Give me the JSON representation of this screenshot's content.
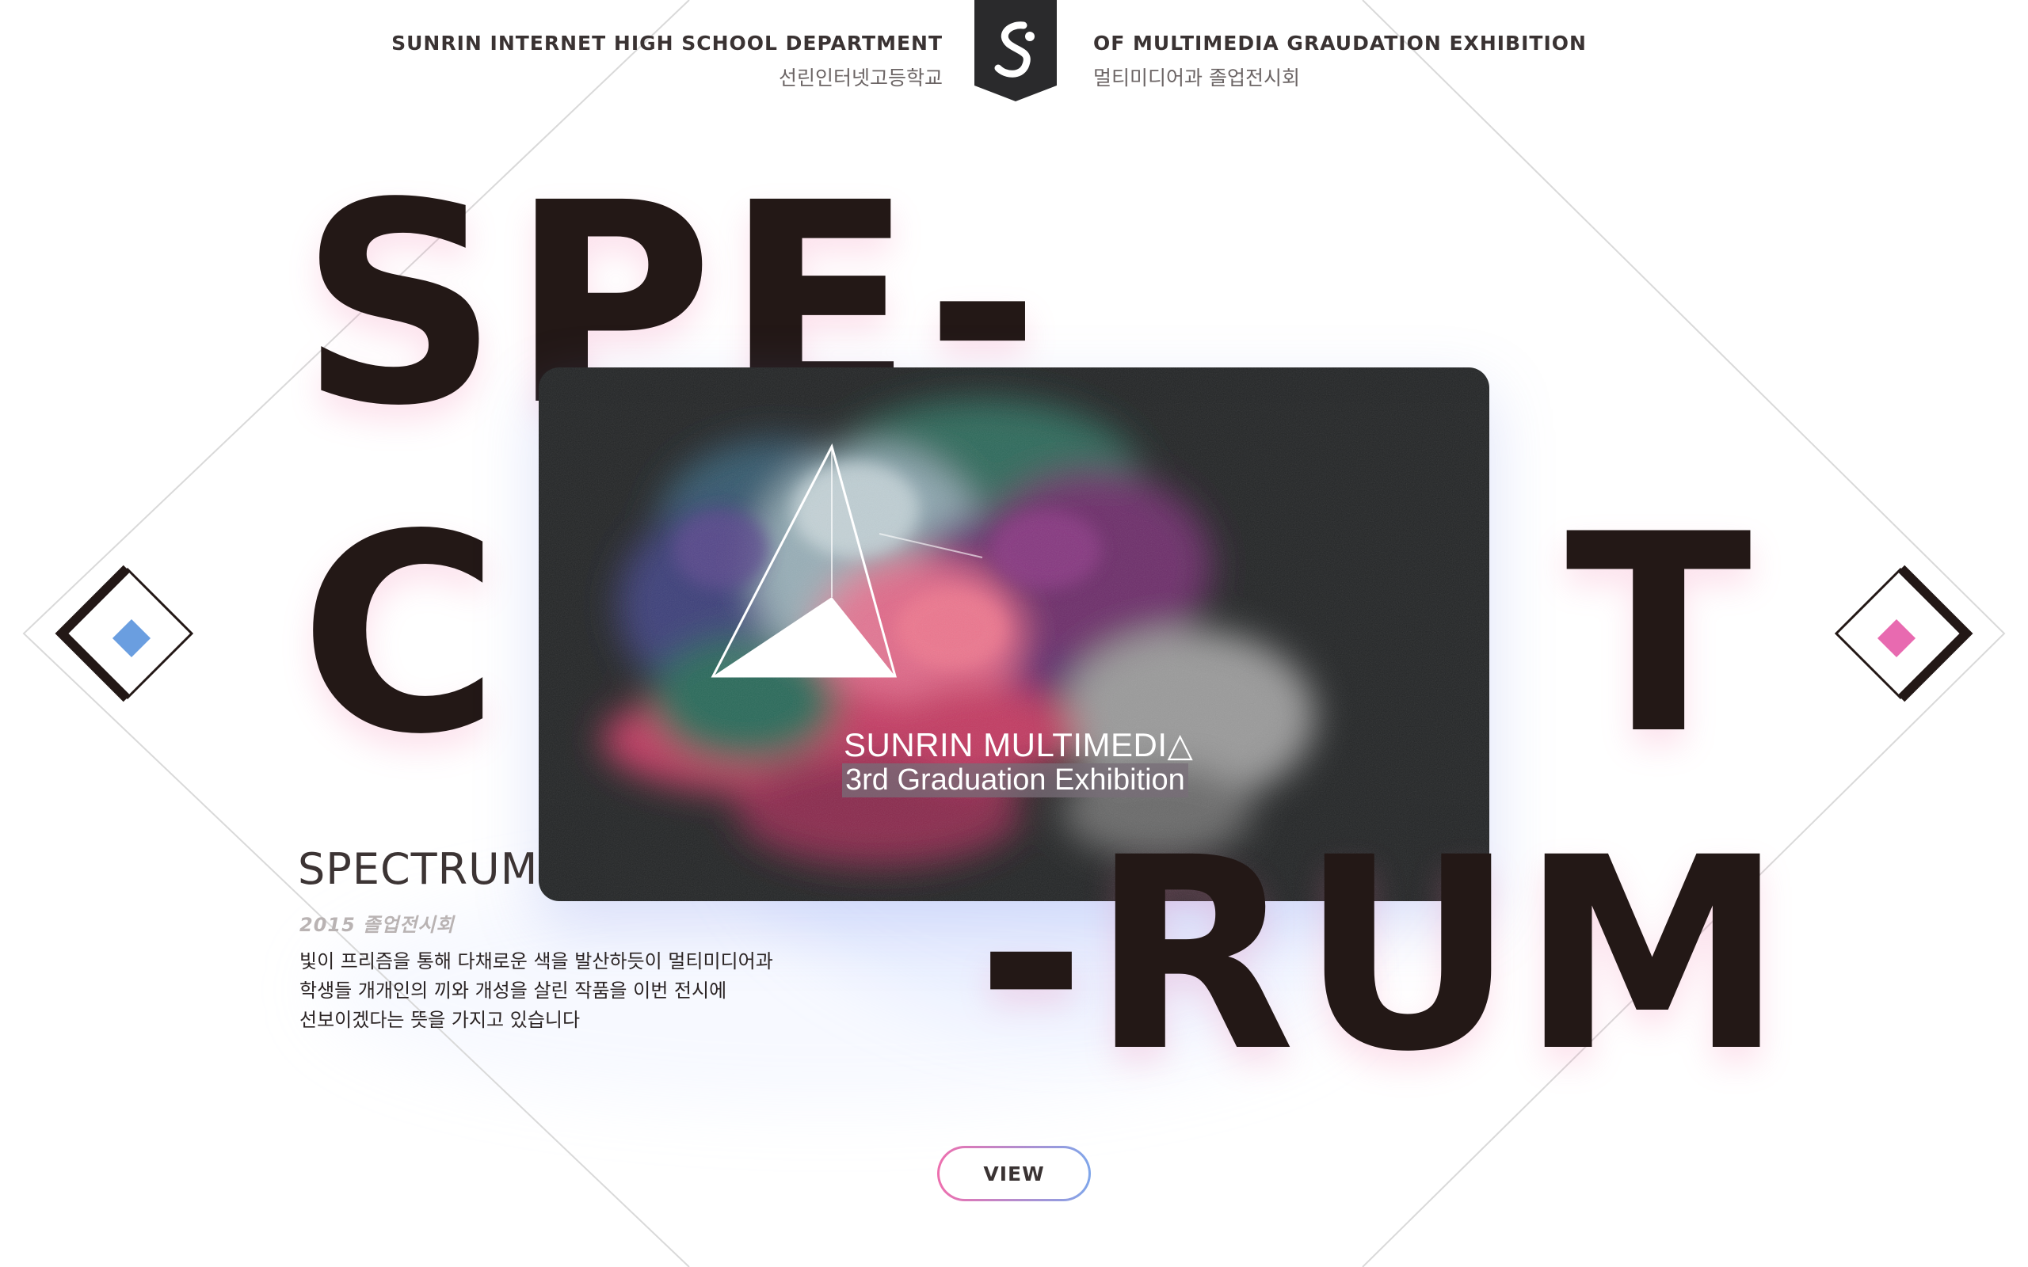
{
  "header": {
    "left_en": "SUNRIN INTERNET HIGH SCHOOL DEPARTMENT",
    "left_ko": "선린인터넷고등학교",
    "right_en": "OF MULTIMEDIA GRAUDATION EXHIBITION",
    "right_ko": "멀티미디어과 졸업전시회",
    "logo_icon": "sunrin-s-logo-icon"
  },
  "hero": {
    "letters_spe": "SPE-",
    "letters_c": "C",
    "letters_t": "T",
    "letters_rum": "-RUM"
  },
  "poster": {
    "title": "SUNRIN MULTIMEDI△",
    "subtitle": "3rd Graduation Exhibition"
  },
  "info": {
    "title": "SPECTRUM",
    "year": "2015  졸업전시회",
    "desc_line1": "빛이 프리즘을 통해 다채로운 색을 발산하듯이 멀티미디어과",
    "desc_line2": "학생들 개개인의 끼와 개성을 살린 작품을 이번 전시에",
    "desc_line3": "선보이겠다는 뜻을 가지고 있습니다"
  },
  "nav": {
    "prev_icon": "prev-diamond-icon",
    "next_icon": "next-diamond-icon",
    "prev_color": "#6a9ee0",
    "next_color": "#e86ab0"
  },
  "view_button": {
    "label": "VIEW"
  },
  "colors": {
    "text_dark": "#231816",
    "poster_bg": "#232526",
    "accent_pink": "#ee6fae",
    "accent_blue": "#7fa6ea"
  }
}
